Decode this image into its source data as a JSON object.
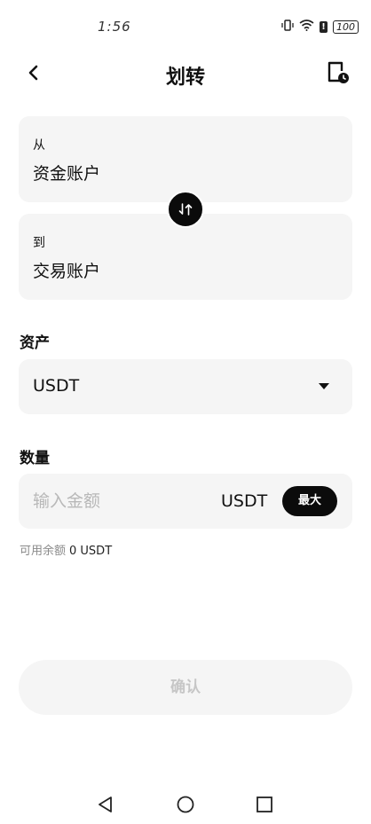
{
  "status_bar": {
    "time": "1:56",
    "battery": "100"
  },
  "header": {
    "title": "划转"
  },
  "from_card": {
    "label": "从",
    "value": "资金账户"
  },
  "to_card": {
    "label": "到",
    "value": "交易账户"
  },
  "asset": {
    "label": "资产",
    "selected": "USDT"
  },
  "amount": {
    "label": "数量",
    "placeholder": "输入金额",
    "unit": "USDT",
    "max_label": "最大"
  },
  "available": {
    "label": "可用余额",
    "value": "0 USDT"
  },
  "confirm_label": "确认",
  "colors": {
    "dark_button": "#0b0b0b",
    "card_bg": "#f5f5f5",
    "disabled_text": "#c6c6c6"
  },
  "icons": [
    "back-icon",
    "transfer-record-icon",
    "swap-icon",
    "dropdown-arrow-icon",
    "nav-back-icon",
    "nav-home-icon",
    "nav-recents-icon"
  ]
}
